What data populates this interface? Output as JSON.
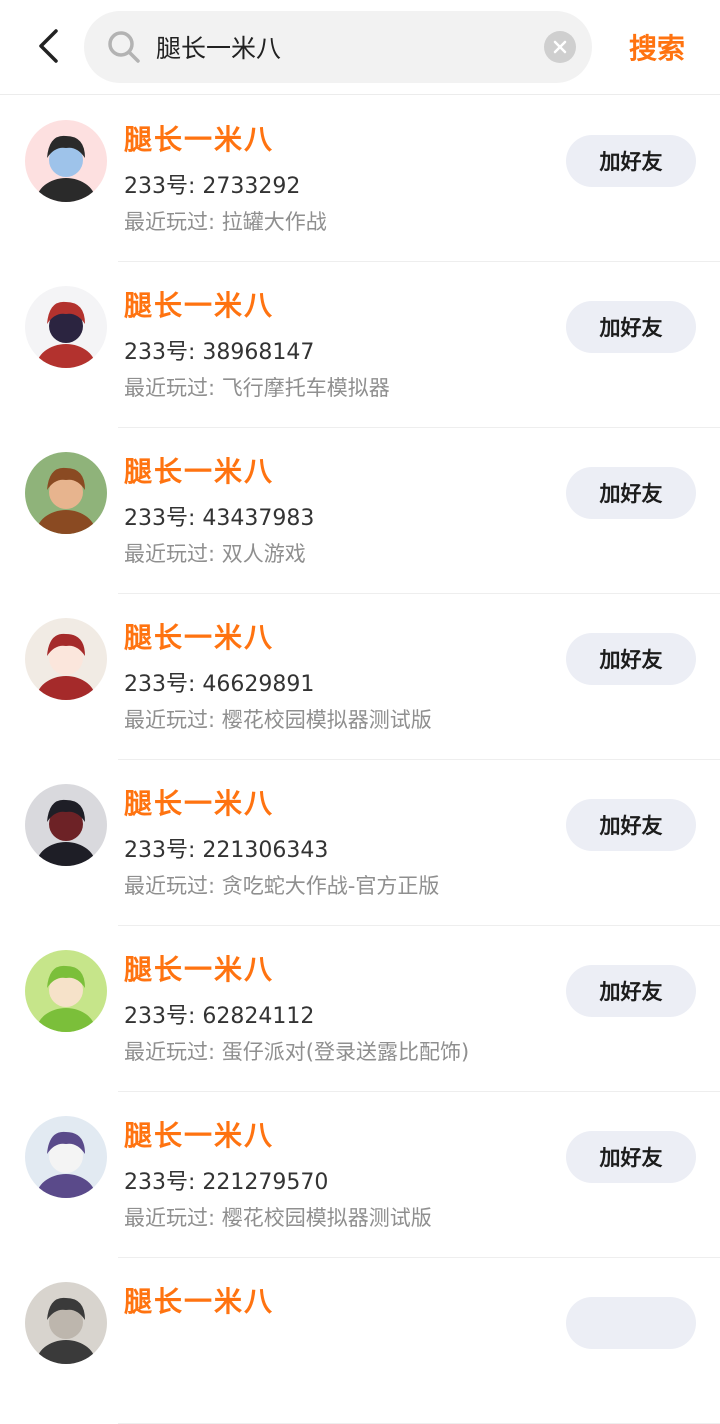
{
  "header": {
    "search_query": "腿长一米八",
    "search_button": "搜索"
  },
  "results": [
    {
      "nickname": "腿长一米八",
      "id_text": "233号: 2733292",
      "recent": "最近玩过: 拉罐大作战",
      "add_label": "加好友",
      "avatar_colors": [
        "#fde0e0",
        "#9ec3ea",
        "#2a2a2a"
      ]
    },
    {
      "nickname": "腿长一米八",
      "id_text": "233号: 38968147",
      "recent": "最近玩过: 飞行摩托车模拟器",
      "add_label": "加好友",
      "avatar_colors": [
        "#f4f4f6",
        "#2b2440",
        "#b3322e"
      ]
    },
    {
      "nickname": "腿长一米八",
      "id_text": "233号: 43437983",
      "recent": "最近玩过: 双人游戏",
      "add_label": "加好友",
      "avatar_colors": [
        "#8fb37a",
        "#e7b48e",
        "#8a4a22"
      ]
    },
    {
      "nickname": "腿长一米八",
      "id_text": "233号: 46629891",
      "recent": "最近玩过: 樱花校园模拟器测试版",
      "add_label": "加好友",
      "avatar_colors": [
        "#f1ebe4",
        "#fbe6dc",
        "#a52a2a"
      ]
    },
    {
      "nickname": "腿长一米八",
      "id_text": "233号: 221306343",
      "recent": "最近玩过: 贪吃蛇大作战-官方正版",
      "add_label": "加好友",
      "avatar_colors": [
        "#d9d9dd",
        "#6d2226",
        "#1e1e26"
      ]
    },
    {
      "nickname": "腿长一米八",
      "id_text": "233号: 62824112",
      "recent": "最近玩过: 蛋仔派对(登录送露比配饰)",
      "add_label": "加好友",
      "avatar_colors": [
        "#c6e58a",
        "#f6e2c9",
        "#7bbf3a"
      ]
    },
    {
      "nickname": "腿长一米八",
      "id_text": "233号: 221279570",
      "recent": "最近玩过: 樱花校园模拟器测试版",
      "add_label": "加好友",
      "avatar_colors": [
        "#e2eaf2",
        "#f4f4f4",
        "#5a4a8a"
      ]
    },
    {
      "nickname": "腿长一米八",
      "id_text": "",
      "recent": "",
      "add_label": "",
      "avatar_colors": [
        "#d8d4ce",
        "#bdb6ad",
        "#3a3a3a"
      ]
    }
  ]
}
